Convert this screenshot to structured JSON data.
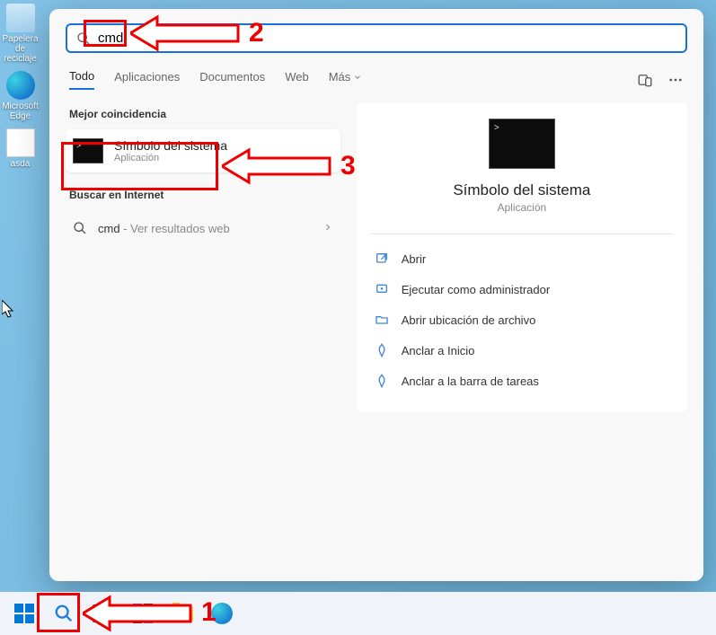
{
  "desktop": {
    "recycle": "Papelera de reciclaje",
    "edge": "Microsoft Edge",
    "doc": "asda"
  },
  "search": {
    "value": "cmd",
    "tabs": {
      "all": "Todo",
      "apps": "Aplicaciones",
      "docs": "Documentos",
      "web": "Web",
      "more": "Más"
    },
    "best_match_h": "Mejor coincidencia",
    "result": {
      "title": "Símbolo del sistema",
      "sub": "Aplicación"
    },
    "internet_h": "Buscar en Internet",
    "web_row": {
      "q": "cmd",
      "sub": " - Ver resultados web"
    }
  },
  "preview": {
    "title": "Símbolo del sistema",
    "sub": "Aplicación",
    "actions": {
      "open": "Abrir",
      "admin": "Ejecutar como administrador",
      "loc": "Abrir ubicación de archivo",
      "pin_start": "Anclar a Inicio",
      "pin_tb": "Anclar a la barra de tareas"
    }
  },
  "anno": {
    "n1": "1",
    "n2": "2",
    "n3": "3"
  }
}
